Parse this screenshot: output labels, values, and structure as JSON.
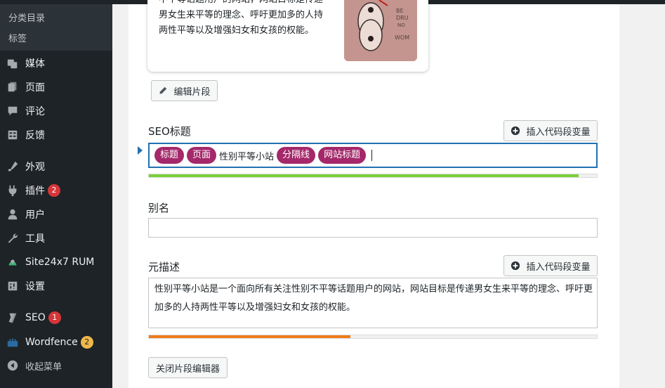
{
  "sidebar": {
    "submenu": [
      {
        "label": "分类目录"
      },
      {
        "label": "标签"
      }
    ],
    "items": [
      {
        "label": "媒体",
        "icon": "media-icon"
      },
      {
        "label": "页面",
        "icon": "page-icon"
      },
      {
        "label": "评论",
        "icon": "comment-icon"
      },
      {
        "label": "反馈",
        "icon": "feedback-icon"
      },
      {
        "label": "外观",
        "icon": "appearance-icon"
      },
      {
        "label": "插件",
        "icon": "plugin-icon",
        "badge": "2"
      },
      {
        "label": "用户",
        "icon": "user-icon"
      },
      {
        "label": "工具",
        "icon": "tools-icon"
      },
      {
        "label": "Site24x7 RUM",
        "icon": "site24x7-icon"
      },
      {
        "label": "设置",
        "icon": "settings-icon"
      },
      {
        "label": "SEO",
        "icon": "yoast-icon",
        "badge": "1"
      },
      {
        "label": "Wordfence",
        "icon": "wordfence-icon",
        "badge": "2"
      },
      {
        "label": "收起菜单",
        "icon": "collapse-icon"
      }
    ]
  },
  "preview": {
    "description": "不平等话题用户的网站，网站目标是传递男女生来平等的理念、呼吁更加多的人持两性平等以及增强妇女和女孩的权能。"
  },
  "editor": {
    "edit_snippet_label": "编辑片段",
    "seo_title_label": "SEO标题",
    "insert_variable_label": "插入代码段变量",
    "seo_title_parts": [
      {
        "type": "tag",
        "text": "标题"
      },
      {
        "type": "tag",
        "text": "页面"
      },
      {
        "type": "text",
        "text": "性别平等小站"
      },
      {
        "type": "tag",
        "text": "分隔线"
      },
      {
        "type": "tag",
        "text": "网站标题"
      }
    ],
    "seo_title_progress": 0.96,
    "slug_label": "别名",
    "slug_value": "",
    "meta_label": "元描述",
    "meta_text": "性别平等小站是一个面向所有关注性别不平等话题用户的网站，网站目标是传递男女生来平等的理念、呼吁更加多的人持两性平等以及增强妇女和女孩的权能。",
    "meta_progress": 0.45,
    "close_label": "关闭片段编辑器"
  },
  "colors": {
    "tag_bg": "#a4286a",
    "title_progress": "#7ad03a",
    "meta_progress": "#ee7c1b",
    "sidebar_bg": "#1d2327",
    "focus_border": "#2271b1"
  }
}
